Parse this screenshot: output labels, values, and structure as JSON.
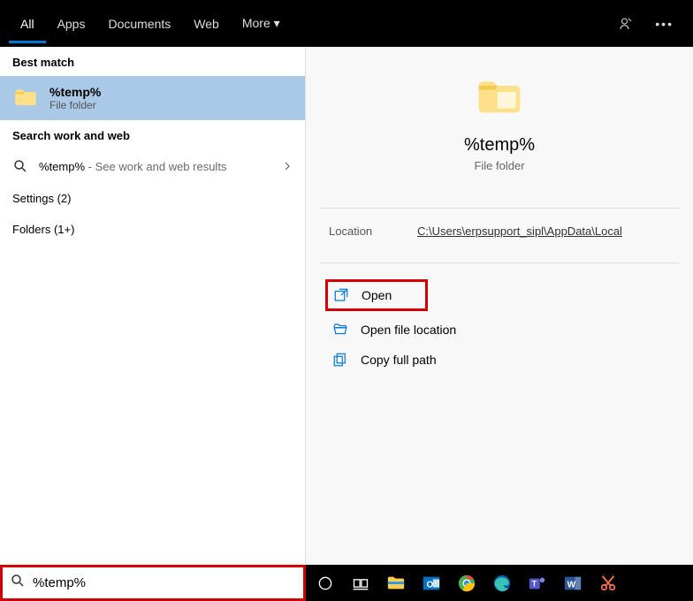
{
  "tabs": {
    "all": "All",
    "apps": "Apps",
    "documents": "Documents",
    "web": "Web",
    "more": "More"
  },
  "left": {
    "bestmatch": "Best match",
    "result_title": "%temp%",
    "result_sub": "File folder",
    "searchwork": "Search work and web",
    "webrow_term": "%temp%",
    "webrow_hint": " - See work and web results",
    "settings": "Settings (2)",
    "folders": "Folders (1+)"
  },
  "right": {
    "title": "%temp%",
    "sub": "File folder",
    "location_label": "Location",
    "location_value": "C:\\Users\\erpsupport_sipl\\AppData\\Local",
    "actions": {
      "open": "Open",
      "open_loc": "Open file location",
      "copy_path": "Copy full path"
    }
  },
  "search": {
    "value": "%temp%"
  }
}
